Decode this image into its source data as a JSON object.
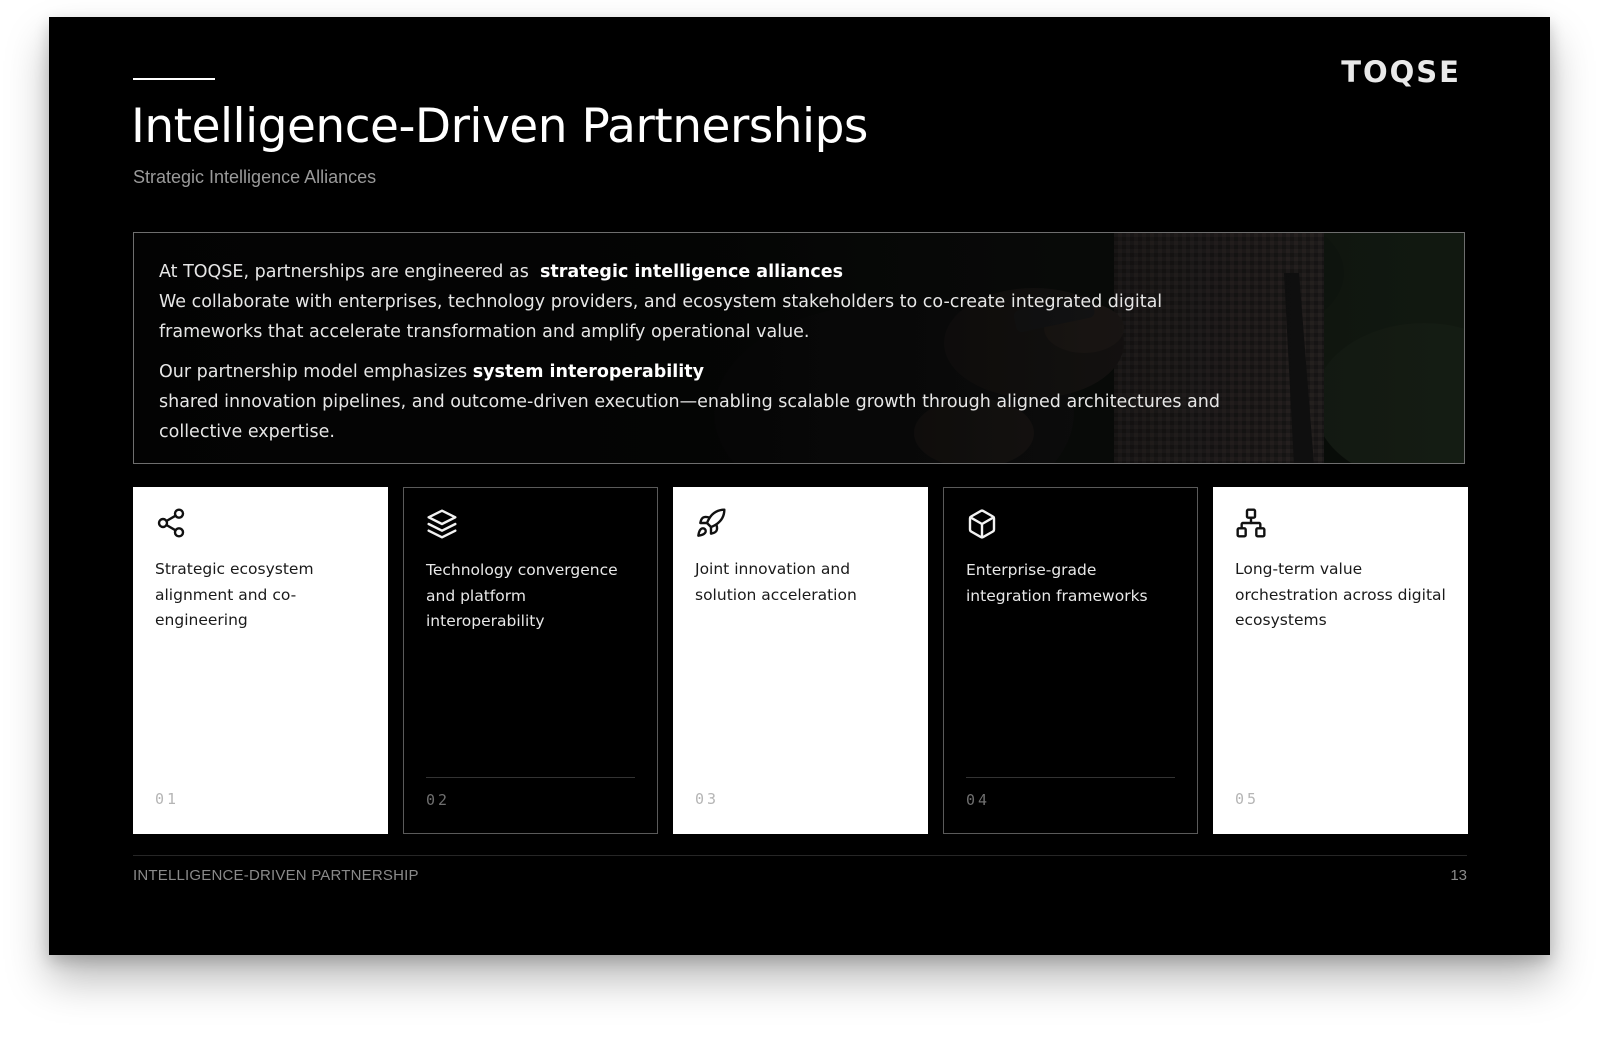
{
  "brand": "TOQSE",
  "title": "Intelligence-Driven Partnerships",
  "subtitle": "Strategic Intelligence Alliances",
  "intro": {
    "p1_lead": "At TOQSE, partnerships are engineered as",
    "p1_highlight": "strategic intelligence alliances",
    "p1_rest": "We collaborate with enterprises, technology providers, and ecosystem stakeholders to co-create integrated digital frameworks that accelerate transformation and amplify operational value.",
    "p2_lead": "Our partnership model emphasizes",
    "p2_highlight": "system interoperability",
    "p2_rest": "shared innovation pipelines, and outcome-driven execution—enabling scalable growth through aligned architectures and collective expertise."
  },
  "cards": [
    {
      "icon": "share-nodes-icon",
      "label": "Strategic ecosystem alignment and co-engineering",
      "number": "01",
      "theme": "light"
    },
    {
      "icon": "layers-icon",
      "label": "Technology convergence and platform interoperability",
      "number": "02",
      "theme": "dark"
    },
    {
      "icon": "rocket-icon",
      "label": "Joint innovation and solution acceleration",
      "number": "03",
      "theme": "light"
    },
    {
      "icon": "cube-icon",
      "label": "Enterprise-grade integration frameworks",
      "number": "04",
      "theme": "dark"
    },
    {
      "icon": "network-hierarchy-icon",
      "label": "Long-term value orchestration across digital ecosystems",
      "number": "05",
      "theme": "light"
    }
  ],
  "footer": {
    "section": "INTELLIGENCE-DRIVEN PARTNERSHIP",
    "page_number": "13"
  },
  "colors": {
    "slide_background": "#000000",
    "card_light": "#ffffff",
    "card_dark": "#000000",
    "muted_text": "#8a8a8a"
  }
}
